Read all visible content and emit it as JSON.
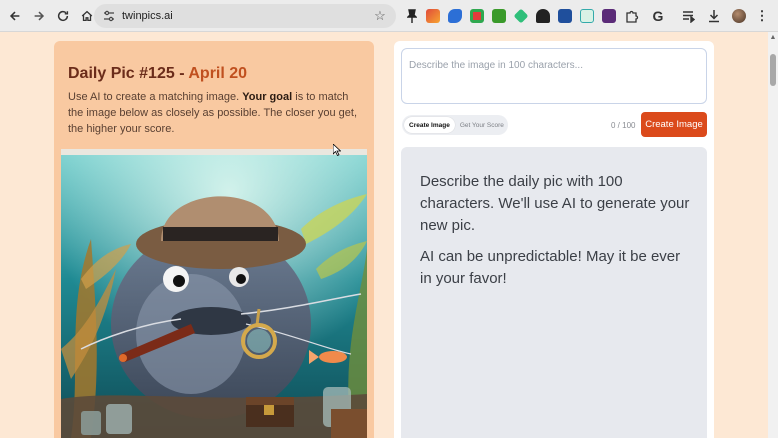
{
  "browser": {
    "url": "twinpics.ai",
    "extension_icons": [
      "pin-icon",
      "megaphone-icon",
      "fish-icon",
      "record-icon",
      "puzzle-green-icon",
      "leaf-icon",
      "hat-icon",
      "image-icon",
      "note-icon",
      "qr-icon",
      "puzzle-icon",
      "google-icon",
      "queue-icon",
      "download-icon",
      "profile-avatar",
      "menu-icon"
    ]
  },
  "header": {
    "title_prefix": "Daily Pic #125 - ",
    "title_date": "April 20",
    "desc_part1": "Use AI to create a matching image. ",
    "desc_bold": "Your goal",
    "desc_part2": " is to match the image below as closely as possible. The closer you get, the higher your score."
  },
  "prompt": {
    "placeholder": "Describe the image in 100 characters...",
    "value": ""
  },
  "tabs": {
    "create": "Create Image",
    "score": "Get Your Score"
  },
  "counter": "0 / 100",
  "create_button": "Create Image",
  "info": {
    "para1": "Describe the daily pic with 100 characters. We'll use AI to generate your new pic.",
    "para2": "AI can be unpredictable! May it be ever in your favor!"
  },
  "colors": {
    "page_bg": "#fde8d4",
    "left_card": "#f9c9a1",
    "title_dark": "#6b2c1a",
    "title_accent": "#c0501f",
    "button": "#db4a1b",
    "info_panel": "#e7e9ee"
  }
}
